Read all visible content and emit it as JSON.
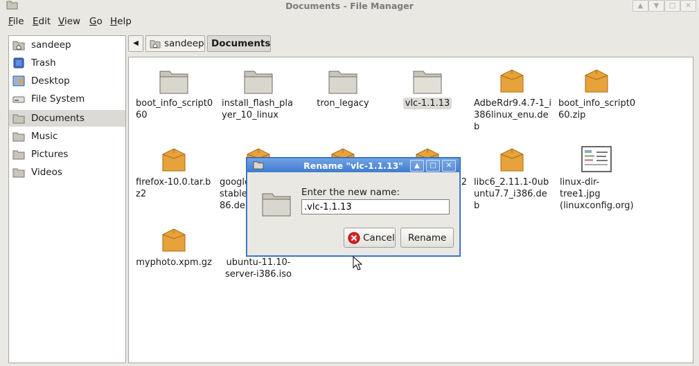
{
  "window": {
    "title": "Documents - File Manager",
    "controls": [
      "▲",
      "▼",
      "□",
      "✕"
    ]
  },
  "menubar": [
    {
      "label": "File"
    },
    {
      "label": "Edit"
    },
    {
      "label": "View"
    },
    {
      "label": "Go"
    },
    {
      "label": "Help"
    }
  ],
  "sidebar": {
    "items": [
      {
        "label": "sandeep",
        "icon": "home-folder-icon"
      },
      {
        "label": "Trash",
        "icon": "trash-icon"
      },
      {
        "label": "Desktop",
        "icon": "desktop-icon"
      },
      {
        "label": "File System",
        "icon": "drive-icon"
      },
      {
        "label": "Documents",
        "icon": "folder-icon",
        "active": true
      },
      {
        "label": "Music",
        "icon": "folder-icon"
      },
      {
        "label": "Pictures",
        "icon": "folder-icon"
      },
      {
        "label": "Videos",
        "icon": "folder-icon"
      }
    ]
  },
  "pathbar": {
    "back_arrow": "◀",
    "crumbs": [
      "sandeep",
      "Documents"
    ]
  },
  "files": [
    {
      "name": "boot_info_script0\n60",
      "type": "folder"
    },
    {
      "name": "install_flash_pla\nyer_10_linux",
      "type": "folder"
    },
    {
      "name": "tron_legacy",
      "type": "folder"
    },
    {
      "name": "vlc-1.1.13",
      "type": "folder",
      "selected": true
    },
    {
      "name": "AdbeRdr9.4.7-1_i\n386linux_enu.de\nb",
      "type": "package"
    },
    {
      "name": "boot_info_script0\n60.zip",
      "type": "package"
    },
    {
      "name": "firefox-10.0.tar.b\nz2",
      "type": "package"
    },
    {
      "name": "google\nstable\n86.deb",
      "type": "package"
    },
    {
      "name": "",
      "type": "package"
    },
    {
      "name": "2",
      "type": "package"
    },
    {
      "name": "libc6_2.11.1-0ub\nuntu7.7_i386.deb",
      "type": "package"
    },
    {
      "name": "linux-dir-\ntree1.jpg\n(linuxconfig.org)",
      "type": "image"
    },
    {
      "name": "myphoto.xpm.gz",
      "type": "package"
    },
    {
      "name": "ubuntu-11.10-\nserver-i386.iso",
      "type": "disc"
    }
  ],
  "dialog": {
    "title": "Rename \"vlc-1.1.13\"",
    "prompt": "Enter the new name:",
    "value": ".vlc-1.1.13",
    "cancel_label": "Cancel",
    "rename_label": "Rename"
  },
  "colors": {
    "accent": "#3f7ccf",
    "folder": "#c9c6b9",
    "package": "#e8a23b"
  }
}
